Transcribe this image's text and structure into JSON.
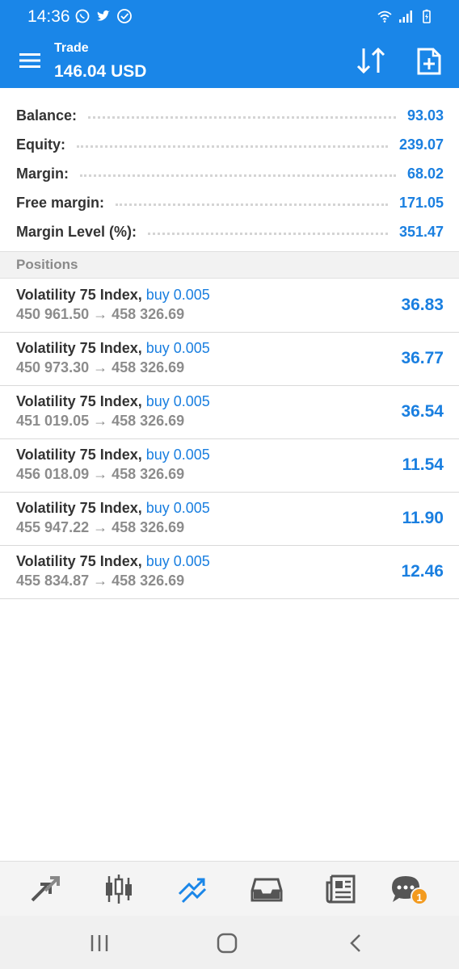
{
  "status_bar": {
    "time": "14:36",
    "left_icons": [
      "whatsapp-icon",
      "twitter-icon",
      "check-circle-icon"
    ],
    "right_icons": [
      "wifi-icon",
      "signal-icon",
      "battery-charging-icon"
    ]
  },
  "app_bar": {
    "title": "Trade",
    "subtitle": "146.04 USD",
    "actions": [
      "sort-icon",
      "new-order-icon"
    ]
  },
  "summary": {
    "balance": {
      "label": "Balance:",
      "value": "93.03"
    },
    "equity": {
      "label": "Equity:",
      "value": "239.07"
    },
    "margin": {
      "label": "Margin:",
      "value": "68.02"
    },
    "free_margin": {
      "label": "Free margin:",
      "value": "171.05"
    },
    "margin_level": {
      "label": "Margin Level (%):",
      "value": "351.47"
    }
  },
  "positions": {
    "header": "Positions",
    "items": [
      {
        "symbol": "Volatility 75 Index,",
        "side": "buy 0.005",
        "prices": "450 961.50 → 458 326.69",
        "profit": "36.83"
      },
      {
        "symbol": "Volatility 75 Index,",
        "side": "buy 0.005",
        "prices": "450 973.30 → 458 326.69",
        "profit": "36.77"
      },
      {
        "symbol": "Volatility 75 Index,",
        "side": "buy 0.005",
        "prices": "451 019.05 → 458 326.69",
        "profit": "36.54"
      },
      {
        "symbol": "Volatility 75 Index,",
        "side": "buy 0.005",
        "prices": "456 018.09 → 458 326.69",
        "profit": "11.54"
      },
      {
        "symbol": "Volatility 75 Index,",
        "side": "buy 0.005",
        "prices": "455 947.22 → 458 326.69",
        "profit": "11.90"
      },
      {
        "symbol": "Volatility 75 Index,",
        "side": "buy 0.005",
        "prices": "455 834.87 → 458 326.69",
        "profit": "12.46"
      }
    ]
  },
  "bottom_nav": {
    "items": [
      "quotes-icon",
      "chart-icon",
      "trade-icon",
      "history-icon",
      "news-icon",
      "messages-icon"
    ],
    "active": "trade-icon",
    "messages_badge": "1"
  },
  "colors": {
    "primary": "#1a86e8",
    "accent_text": "#1a7fe0",
    "badge": "#f39a1e"
  }
}
